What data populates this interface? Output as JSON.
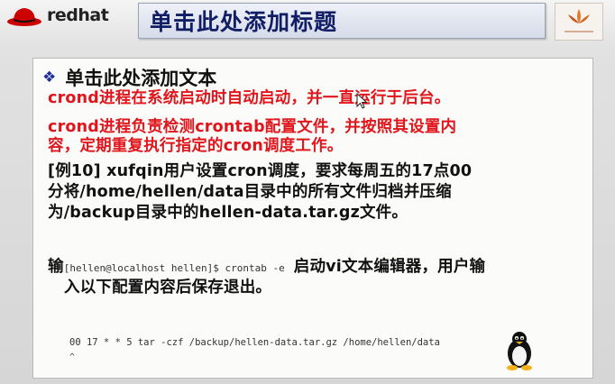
{
  "logo": {
    "brand_text": "redhat"
  },
  "slide": {
    "title": "单击此处添加标题",
    "subtitle": "单击此处添加文本",
    "red_line_1": "crond进程在系统启动时自动启动，并一直运行于后台。",
    "red_line_2": "crond进程负责检测crontab配置文件，并按照其设置内",
    "red_line_3": "容，定期重复执行指定的cron调度工作。",
    "example_line_1": "[例10]  xufqin用户设置cron调度，要求每周五的17点00",
    "example_line_2": "分将/home/hellen/data目录中的所有文件归档并压缩",
    "example_line_3": "为/backup目录中的hellen-data.tar.gz文件。",
    "input_prefix": "输",
    "terminal_prompt": "[hellen@localhost hellen]$ crontab -e",
    "input_suffix": "启动vi文本编辑器，用户输",
    "input_line_2": "入以下配置内容后保存退出。",
    "cron_entry": "00 17 * * 5 tar -czf /backup/hellen-data.tar.gz /home/hellen/data",
    "cron_caret": "^"
  },
  "colors": {
    "title": "#111e66",
    "red_text": "#e0161c",
    "bullet": "#1f2f9a"
  }
}
